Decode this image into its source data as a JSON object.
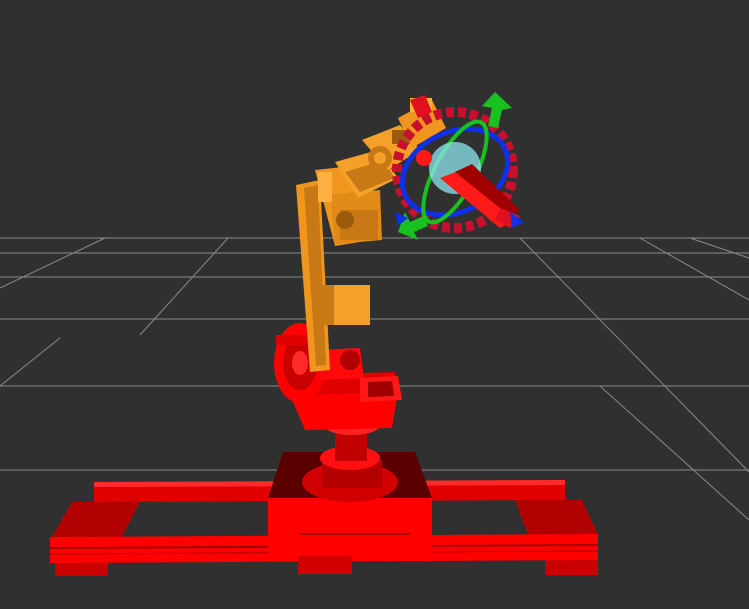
{
  "colors": {
    "background": "#303030",
    "grid_line": "#9a9a9a",
    "rail_red": "#ff0000",
    "rail_red_shade": "#c40000",
    "rail_red_dark": "#8c0000",
    "arm_orange": "#f0961e",
    "arm_orange_shade": "#c87814",
    "arm_orange_dark": "#9a5c0c",
    "marker_ring_red": "#c8102e",
    "marker_ring_blue": "#1030e8",
    "marker_ring_green": "#18c020",
    "marker_sphere_cyan": "#8ee6f0"
  },
  "scene": {
    "grid": "visible",
    "robot": "industrial-arm-on-linear-rail",
    "interactive_marker": "6dof-pose-marker"
  }
}
